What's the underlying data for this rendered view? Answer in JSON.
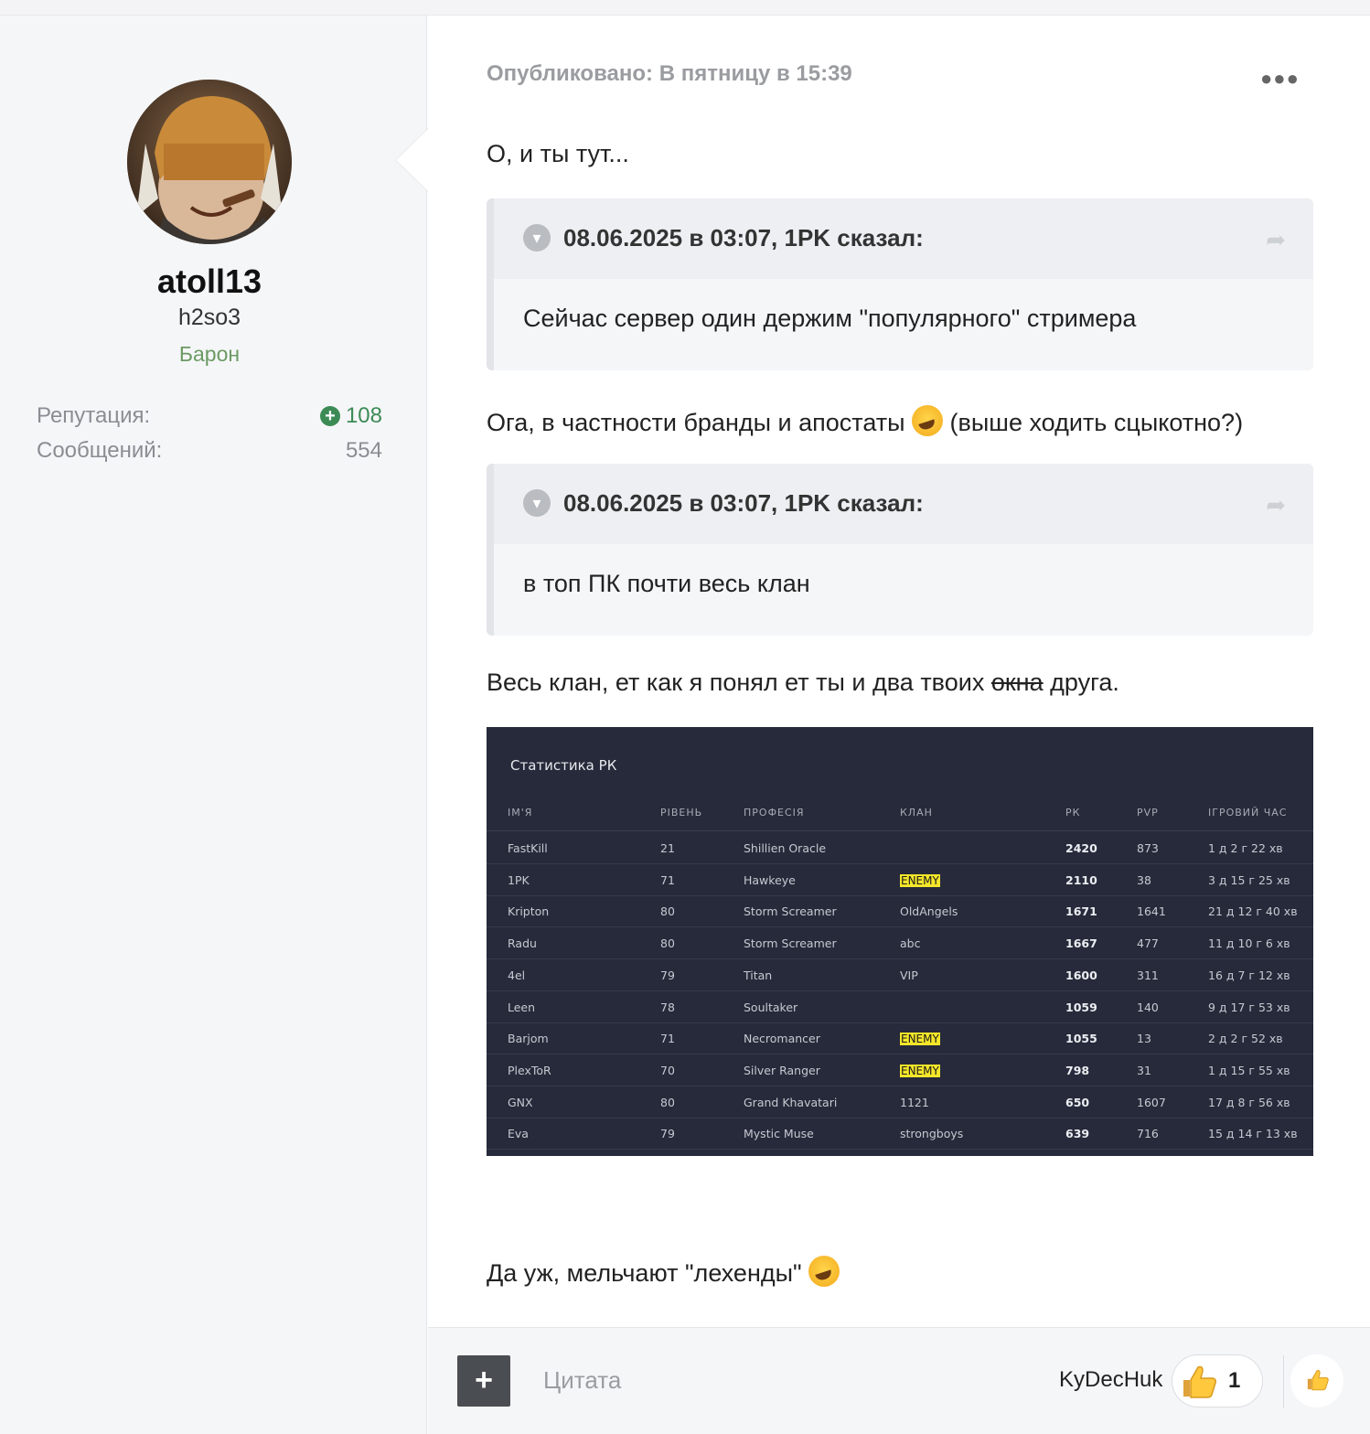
{
  "author": {
    "name": "atoll13",
    "title": "h2so3",
    "rank": "Барон",
    "reputation_label": "Репутация:",
    "reputation_value": "108",
    "posts_label": "Сообщений:",
    "posts_value": "554"
  },
  "post": {
    "meta": "Опубликовано: В пятницу в 15:39",
    "menu_icon": "more-dots-icon",
    "p1": "О, и ты тут...",
    "quote1": {
      "cite": "08.06.2025 в 03:07, 1PK сказал:",
      "body": "Сейчас сервер один держим \"популярного\" стримера"
    },
    "p2_before": "Ога, в частности бранды и апостаты",
    "p2_after": "(выше ходить сцыкотно?)",
    "quote2": {
      "cite": "08.06.2025 в 03:07, 1PK сказал:",
      "body": "в топ ПК почти весь клан"
    },
    "p3_before": "Весь клан, ет как я понял ет ты и два твоих",
    "p3_strike": "окна",
    "p3_after": "друга.",
    "p4": "Да уж, мельчают \"лехенды\""
  },
  "stats_image": {
    "title": "Статистика РК",
    "headers": [
      "ІМ'Я",
      "РІВЕНЬ",
      "ПРОФЕСІЯ",
      "КЛАН",
      "РК",
      "PVP",
      "ІГРОВИЙ ЧАС"
    ],
    "rows": [
      [
        "FastKill",
        "21",
        "Shillien Oracle",
        "",
        "2420",
        "873",
        "1 д 2 г 22 хв"
      ],
      [
        "1PK",
        "71",
        "Hawkeye",
        "ENEMY",
        "2110",
        "38",
        "3 д 15 г 25 хв"
      ],
      [
        "Kripton",
        "80",
        "Storm Screamer",
        "OldAngels",
        "1671",
        "1641",
        "21 д 12 г 40 хв"
      ],
      [
        "Radu",
        "80",
        "Storm Screamer",
        "abc",
        "1667",
        "477",
        "11 д 10 г 6 хв"
      ],
      [
        "4el",
        "79",
        "Titan",
        "VIP",
        "1600",
        "311",
        "16 д 7 г 12 хв"
      ],
      [
        "Leen",
        "78",
        "Soultaker",
        "",
        "1059",
        "140",
        "9 д 17 г 53 хв"
      ],
      [
        "Barjom",
        "71",
        "Necromancer",
        "ENEMY",
        "1055",
        "13",
        "2 д 2 г 52 хв"
      ],
      [
        "PlexToR",
        "70",
        "Silver Ranger",
        "ENEMY",
        "798",
        "31",
        "1 д 15 г 55 хв"
      ],
      [
        "GNX",
        "80",
        "Grand Khavatari",
        "1121",
        "650",
        "1607",
        "17 д 8 г 56 хв"
      ],
      [
        "Eva",
        "79",
        "Mystic Muse",
        "strongboys",
        "639",
        "716",
        "15 д 14 г 13 хв"
      ]
    ]
  },
  "footer": {
    "add_icon": "plus-icon",
    "quote_label": "Цитата",
    "reactor_name": "KyDecHuk",
    "reaction_icon": "thumbs-up-icon",
    "reaction_count": "1"
  },
  "colors": {
    "reputation": "#3c8b55",
    "rank": "#6b9a63",
    "enemy_highlight": "#f4e62a",
    "stats_bg": "#262a3a"
  }
}
